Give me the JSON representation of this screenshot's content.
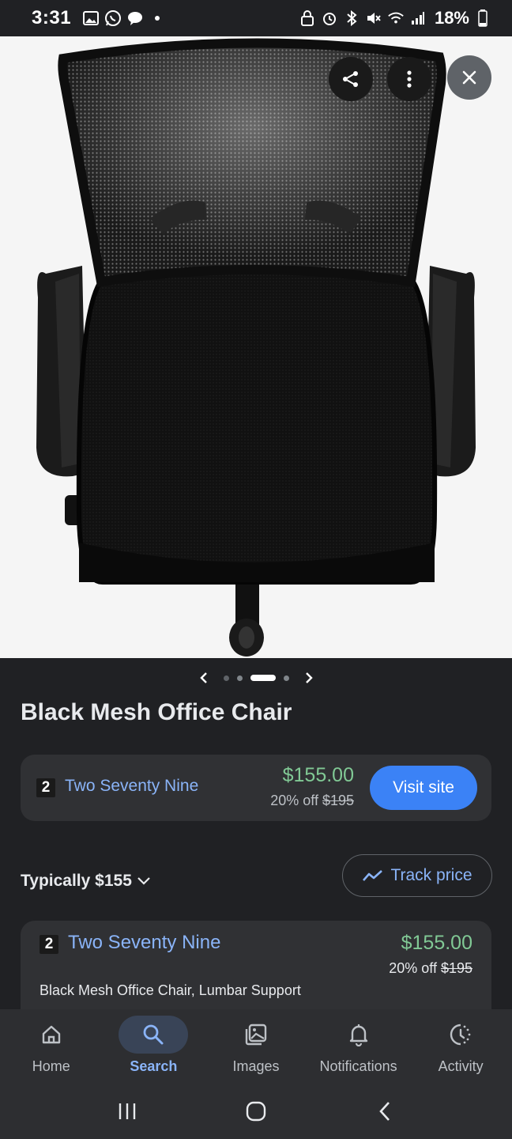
{
  "status_bar": {
    "time": "3:31",
    "battery": "18%"
  },
  "product": {
    "title": "Black Mesh Office Chair"
  },
  "carousel": {
    "dot_count": 4,
    "active_index": 2
  },
  "merchant": {
    "rank": "2",
    "name": "Two Seventy Nine",
    "price": "$155.00",
    "discount_prefix": "20% off ",
    "original_price": "$195",
    "visit_label": "Visit site"
  },
  "price_info": {
    "typically": "Typically $155",
    "track_label": "Track price"
  },
  "offer": {
    "rank": "2",
    "name": "Two Seventy Nine",
    "price": "$155.00",
    "discount_prefix": "20% off ",
    "original_price": "$195",
    "description": "Black Mesh Office Chair, Lumbar Support"
  },
  "bottom_nav": {
    "items": [
      {
        "label": "Home",
        "icon": "home-icon"
      },
      {
        "label": "Search",
        "icon": "search-icon"
      },
      {
        "label": "Images",
        "icon": "images-icon"
      },
      {
        "label": "Notifications",
        "icon": "bell-icon"
      },
      {
        "label": "Activity",
        "icon": "activity-icon"
      }
    ],
    "active": "Search"
  },
  "colors": {
    "background": "#202124",
    "link_blue": "#8ab4f8",
    "price_green": "#81c995",
    "button_blue": "#3b82f6"
  }
}
